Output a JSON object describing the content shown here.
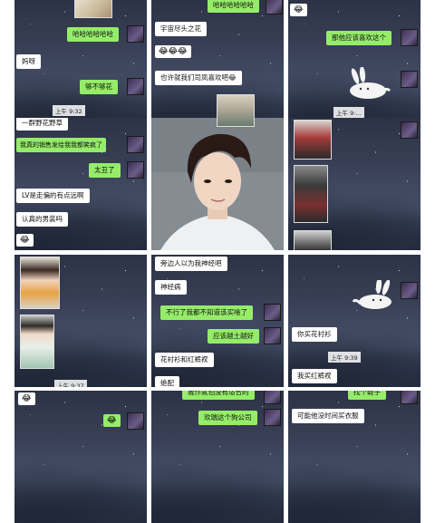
{
  "colors": {
    "green_bubble": "#95ec69",
    "white_bubble": "#ffffff",
    "background": "#2e3548"
  },
  "cells": {
    "c1": {
      "messages": [
        "哈哈哈哈哈哈",
        "妈呀",
        "够不够花"
      ],
      "time": "上午 9:32"
    },
    "c2": {
      "messages": [
        "哈哈哈哈哈哈",
        "宇宙尽头之花",
        "😂😂😂",
        "也许就我们司凤喜欢吧😂"
      ]
    },
    "c3": {
      "messages": [
        "😂",
        "那他应该喜欢这个"
      ],
      "time": "上午 9:..."
    },
    "c4": {
      "messages": [
        "一群野花野草",
        "我真的销售发给我我都笑疯了",
        "太丑了",
        "LV是走偏的有点远啊",
        "认真的男装吗",
        "😂"
      ]
    },
    "c6": {
      "messages": []
    },
    "c7": {
      "messages": [],
      "time": "上午 9:37"
    },
    "c8": {
      "messages": [
        "旁边人以为我神经吧",
        "神经病",
        "不行了我都不知道该买啥了",
        "应该越土越好",
        "花衬衫和红裤衩",
        "绝配"
      ]
    },
    "c9": {
      "messages": [
        "你买花衬衫",
        "我买红裤衩"
      ],
      "time": "上午 9:39"
    },
    "c10": {
      "messages": [
        "😂",
        "😂"
      ]
    },
    "c11": {
      "messages": [
        "我作就怕没有适合的",
        "欢瑞这个狗公司"
      ]
    },
    "c12": {
      "messages": [
        "找个鞋子",
        "可能他没时间买衣服"
      ]
    }
  }
}
